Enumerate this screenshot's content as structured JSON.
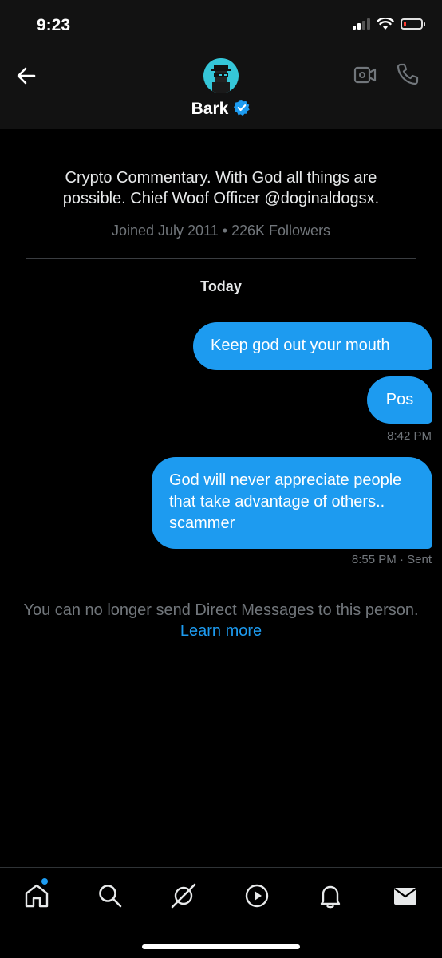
{
  "status_bar": {
    "time": "9:23",
    "battery_level": 0.15,
    "icons": [
      "cellular-signal-icon",
      "wifi-icon",
      "battery-icon"
    ]
  },
  "header": {
    "name": "Bark",
    "verified": true,
    "icons": [
      "back-arrow-icon",
      "video-call-icon",
      "phone-icon"
    ]
  },
  "profile": {
    "bio": "Crypto Commentary. With God all things are possible. Chief Woof Officer @doginaldogsx.",
    "meta": "Joined July 2011 • 226K Followers"
  },
  "conversation": {
    "day_label": "Today",
    "messages": [
      {
        "text": "Keep god out your mouth"
      },
      {
        "text": "Pos",
        "time": "8:42 PM"
      },
      {
        "text": "God will never appreciate people that take advantage of others.. scammer",
        "time": "8:55 PM",
        "status": "· Sent"
      }
    ],
    "notice": "You can no longer send Direct Messages to this person.",
    "learn_more": "Learn more"
  },
  "tabbar": {
    "items": [
      "home-icon",
      "search-icon",
      "grok-icon",
      "video-icon",
      "notifications-icon",
      "messages-icon"
    ],
    "home_has_badge": true
  },
  "colors": {
    "accent": "#1d9bf0",
    "background": "#000000",
    "header_background": "#121212",
    "muted_text": "#71767b",
    "battery_low": "#ff3b30",
    "avatar_bg": "#35c6d8"
  }
}
